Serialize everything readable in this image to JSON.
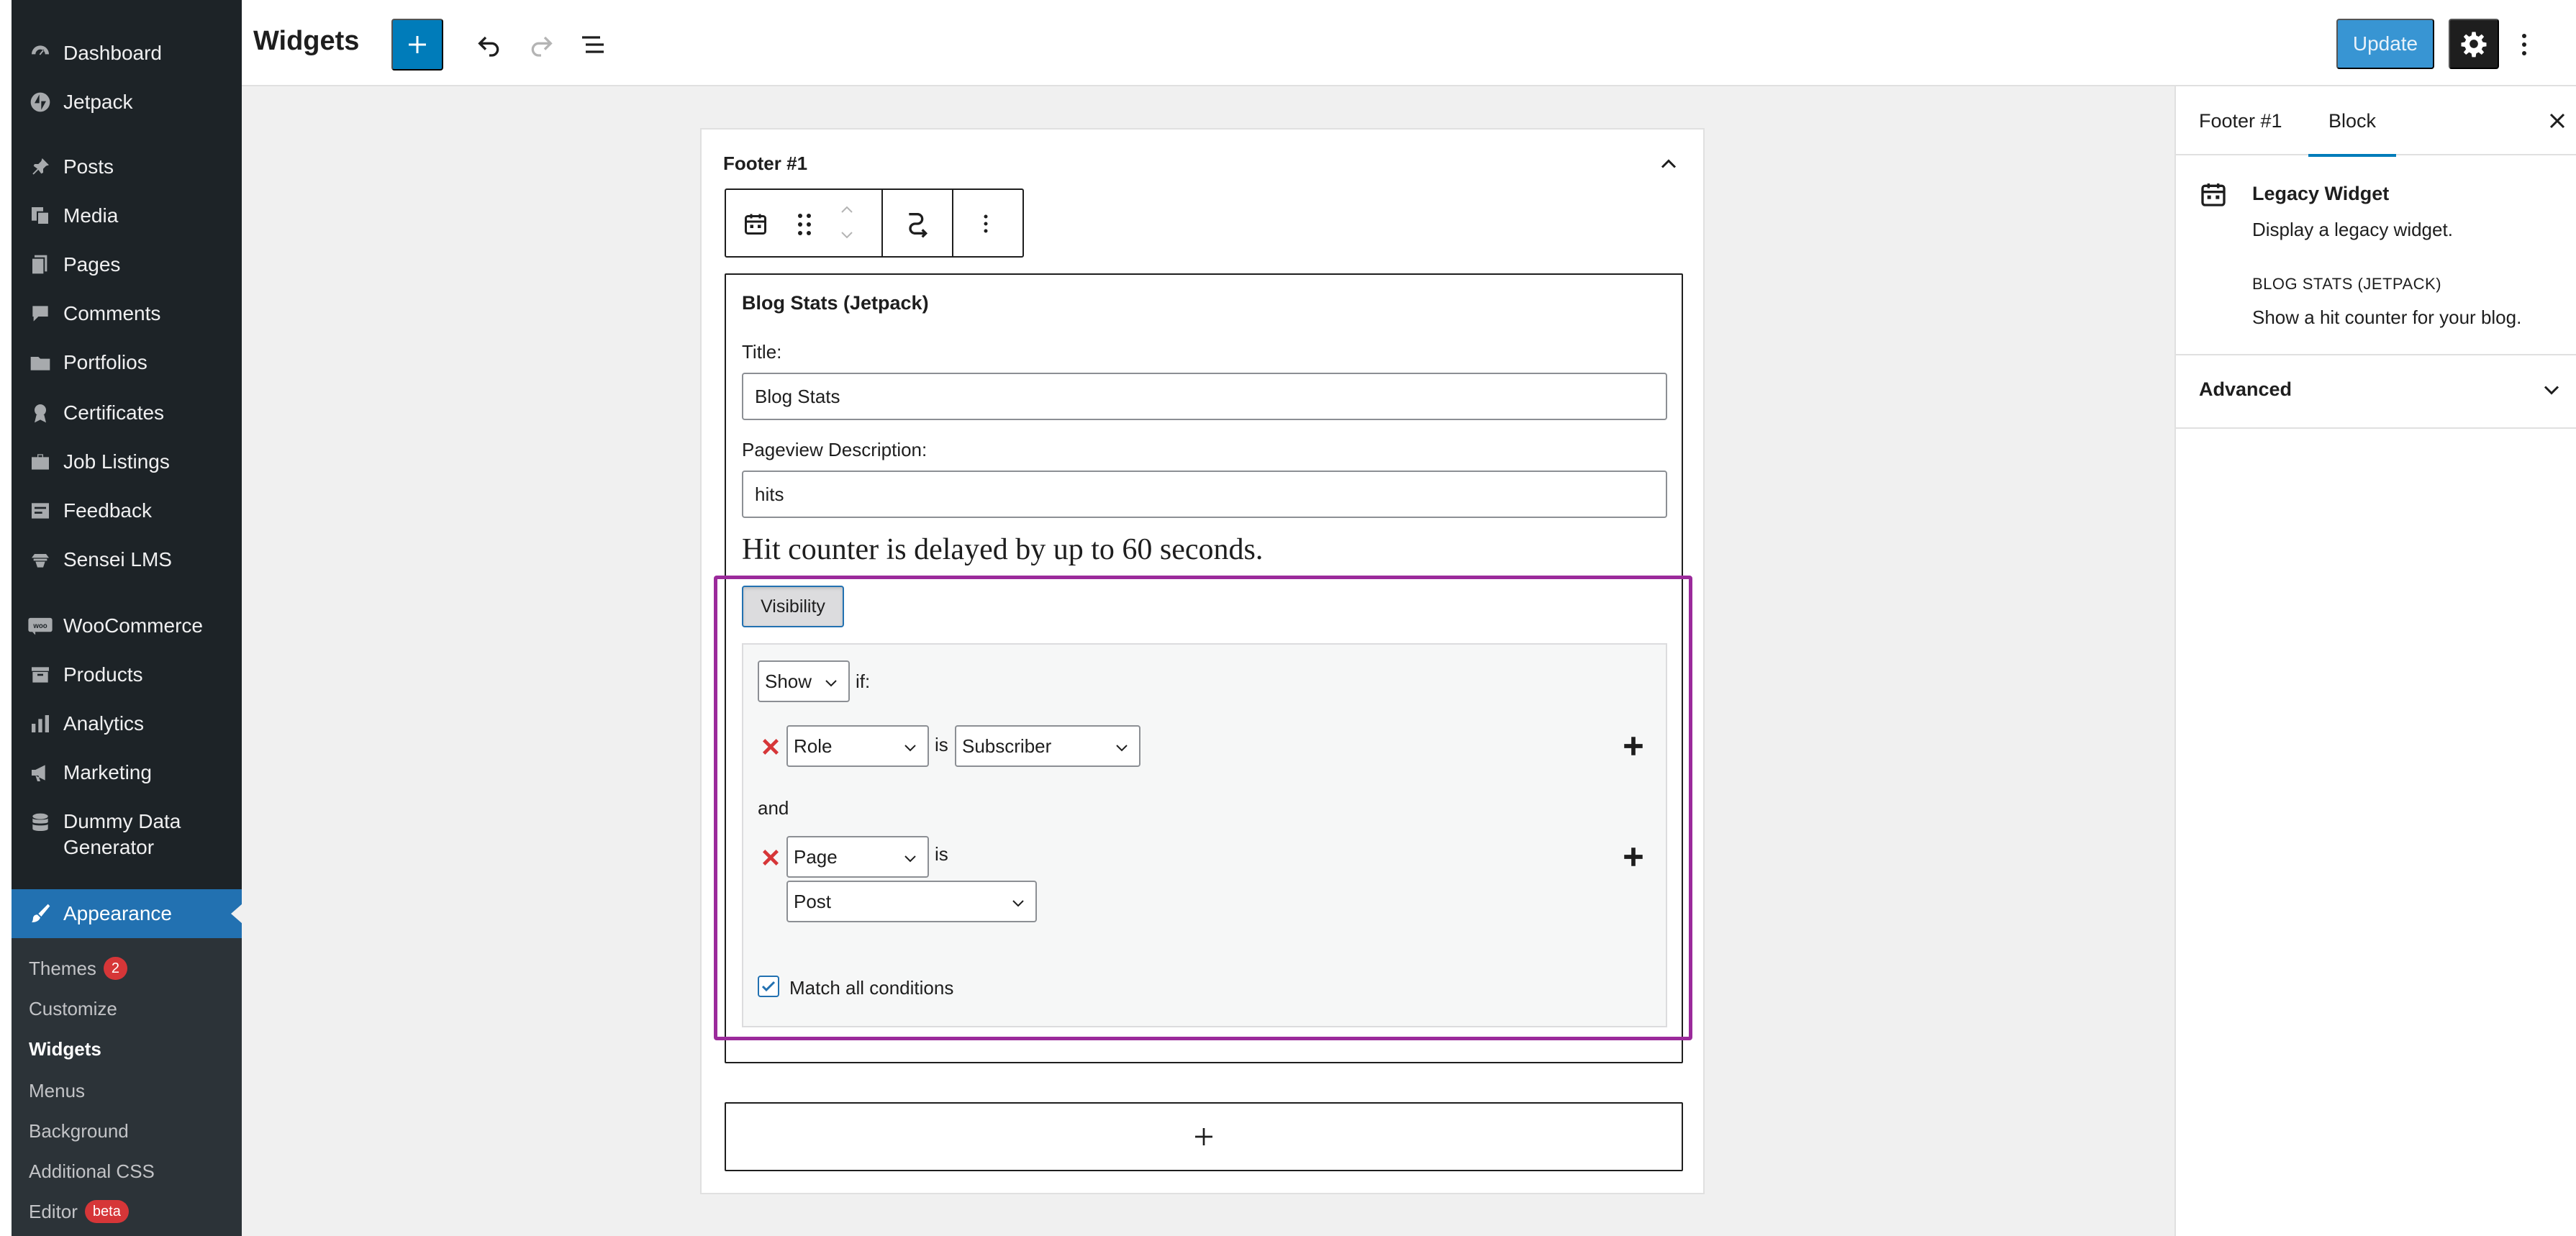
{
  "admin_menu": {
    "items": [
      {
        "label": "Dashboard",
        "icon": "dashboard-icon"
      },
      {
        "label": "Jetpack",
        "icon": "jetpack-icon"
      },
      {
        "label": "Posts",
        "icon": "pin-icon"
      },
      {
        "label": "Media",
        "icon": "media-icon"
      },
      {
        "label": "Pages",
        "icon": "pages-icon"
      },
      {
        "label": "Comments",
        "icon": "comment-icon"
      },
      {
        "label": "Portfolios",
        "icon": "folder-icon"
      },
      {
        "label": "Certificates",
        "icon": "award-icon"
      },
      {
        "label": "Job Listings",
        "icon": "briefcase-icon"
      },
      {
        "label": "Feedback",
        "icon": "feedback-icon"
      },
      {
        "label": "Sensei LMS",
        "icon": "sensei-icon"
      },
      {
        "label": "WooCommerce",
        "icon": "woo-icon"
      },
      {
        "label": "Products",
        "icon": "archive-icon"
      },
      {
        "label": "Analytics",
        "icon": "chart-bar-icon"
      },
      {
        "label": "Marketing",
        "icon": "megaphone-icon"
      },
      {
        "label": "Dummy Data Generator",
        "label_line1": "Dummy Data",
        "label_line2": "Generator",
        "icon": "database-icon"
      },
      {
        "label": "Appearance",
        "icon": "brush-icon",
        "active": true
      }
    ],
    "submenu": [
      {
        "label": "Themes",
        "badge": "2"
      },
      {
        "label": "Customize"
      },
      {
        "label": "Widgets",
        "current": true
      },
      {
        "label": "Menus"
      },
      {
        "label": "Background"
      },
      {
        "label": "Additional CSS"
      },
      {
        "label": "Editor",
        "badge": "beta"
      }
    ]
  },
  "header": {
    "title": "Widgets",
    "update_label": "Update"
  },
  "widget_area": {
    "title": "Footer #1",
    "legacy_widget": {
      "title": "Blog Stats (Jetpack)",
      "title_label": "Title:",
      "title_value": "Blog Stats",
      "pageview_label": "Pageview Description:",
      "pageview_value": "hits",
      "note": "Hit counter is delayed by up to 60 seconds.",
      "visibility_label": "Visibility",
      "visibility": {
        "action_value": "Show",
        "if_label": "if:",
        "rule1": {
          "major": "Role",
          "is_label": "is",
          "minor": "Subscriber"
        },
        "and_label": "and",
        "rule2": {
          "major": "Page",
          "is_label": "is",
          "minor": "Post"
        },
        "match_all_label": "Match all conditions",
        "match_all_checked": true
      }
    },
    "appender_symbol": "+"
  },
  "inspector": {
    "tabs": [
      "Footer #1",
      "Block"
    ],
    "active_tab": "Block",
    "block_card": {
      "title": "Legacy Widget",
      "description": "Display a legacy widget.",
      "widget_name": "BLOG STATS (JETPACK)",
      "widget_description": "Show a hit counter for your blog."
    },
    "advanced_label": "Advanced"
  },
  "colors": {
    "admin_bg": "#1d2327",
    "accent": "#007cba",
    "highlight_frame": "#9b2a9b",
    "remove_red": "#d63638"
  }
}
